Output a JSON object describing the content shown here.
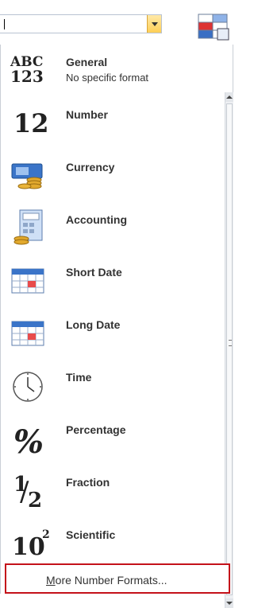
{
  "combo": {
    "value": ""
  },
  "items": [
    {
      "label": "General",
      "sub": "No specific format",
      "icon": "abc-123-icon",
      "glyph_top": "ABC",
      "glyph_bottom": "123"
    },
    {
      "label": "Number",
      "icon": "number-12-icon",
      "glyph": "12"
    },
    {
      "label": "Currency",
      "icon": "currency-icon"
    },
    {
      "label": "Accounting",
      "icon": "accounting-icon"
    },
    {
      "label": "Short Date",
      "icon": "calendar-icon"
    },
    {
      "label": "Long Date",
      "icon": "calendar-icon"
    },
    {
      "label": "Time",
      "icon": "clock-icon"
    },
    {
      "label": "Percentage",
      "icon": "percent-icon",
      "glyph": "%"
    },
    {
      "label": "Fraction",
      "icon": "fraction-icon",
      "glyph_num": "1",
      "glyph_den": "2"
    },
    {
      "label": "Scientific",
      "icon": "scientific-icon",
      "glyph_base": "10",
      "glyph_exp": "2"
    }
  ],
  "footer": {
    "label_first": "M",
    "label_rest": "ore Number Formats..."
  },
  "colors": {
    "accent_red": "#c4121a",
    "dropdown_gold": "#ffcf55"
  }
}
